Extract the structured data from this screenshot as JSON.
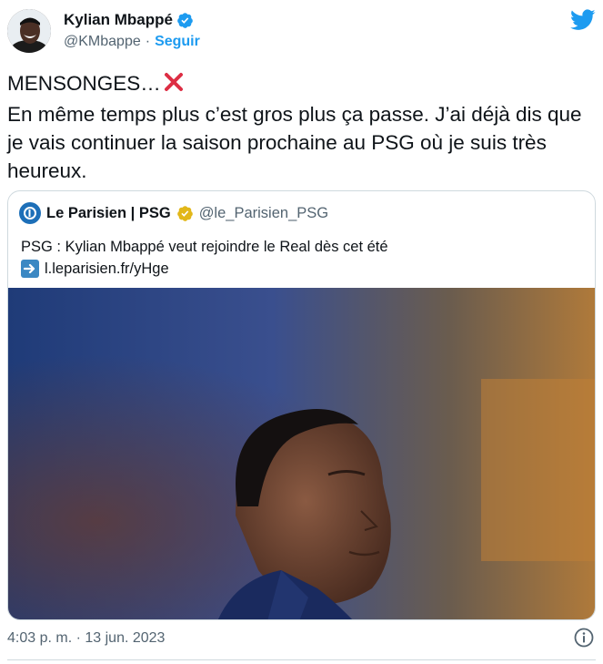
{
  "author": {
    "name": "Kylian Mbappé",
    "handle": "@KMbappe",
    "separator": "·",
    "follow_label": "Seguir",
    "verified": true,
    "avatar_icon": "profile-photo"
  },
  "tweet": {
    "line1": "MENSONGES…",
    "line1_emoji": "cross-mark-icon",
    "line2": "En même temps plus c’est gros plus ça passe. J’ai déjà dis que je vais continuer la saison prochaine au PSG où je suis très heureux."
  },
  "quoted": {
    "name": "Le Parisien | PSG",
    "handle": "@le_Parisien_PSG",
    "verified_color": "#e2b719",
    "text": "PSG : Kylian Mbappé veut rejoindre le Real dès cet été",
    "link": "l.leparisien.fr/yHge",
    "link_emoji": "right-arrow-icon"
  },
  "footer": {
    "timestamp": "4:03 p. m. · 13 jun. 2023"
  },
  "colors": {
    "accent": "#1d9bf0",
    "text": "#0f1419",
    "muted": "#536471",
    "border": "#cfd9de"
  }
}
